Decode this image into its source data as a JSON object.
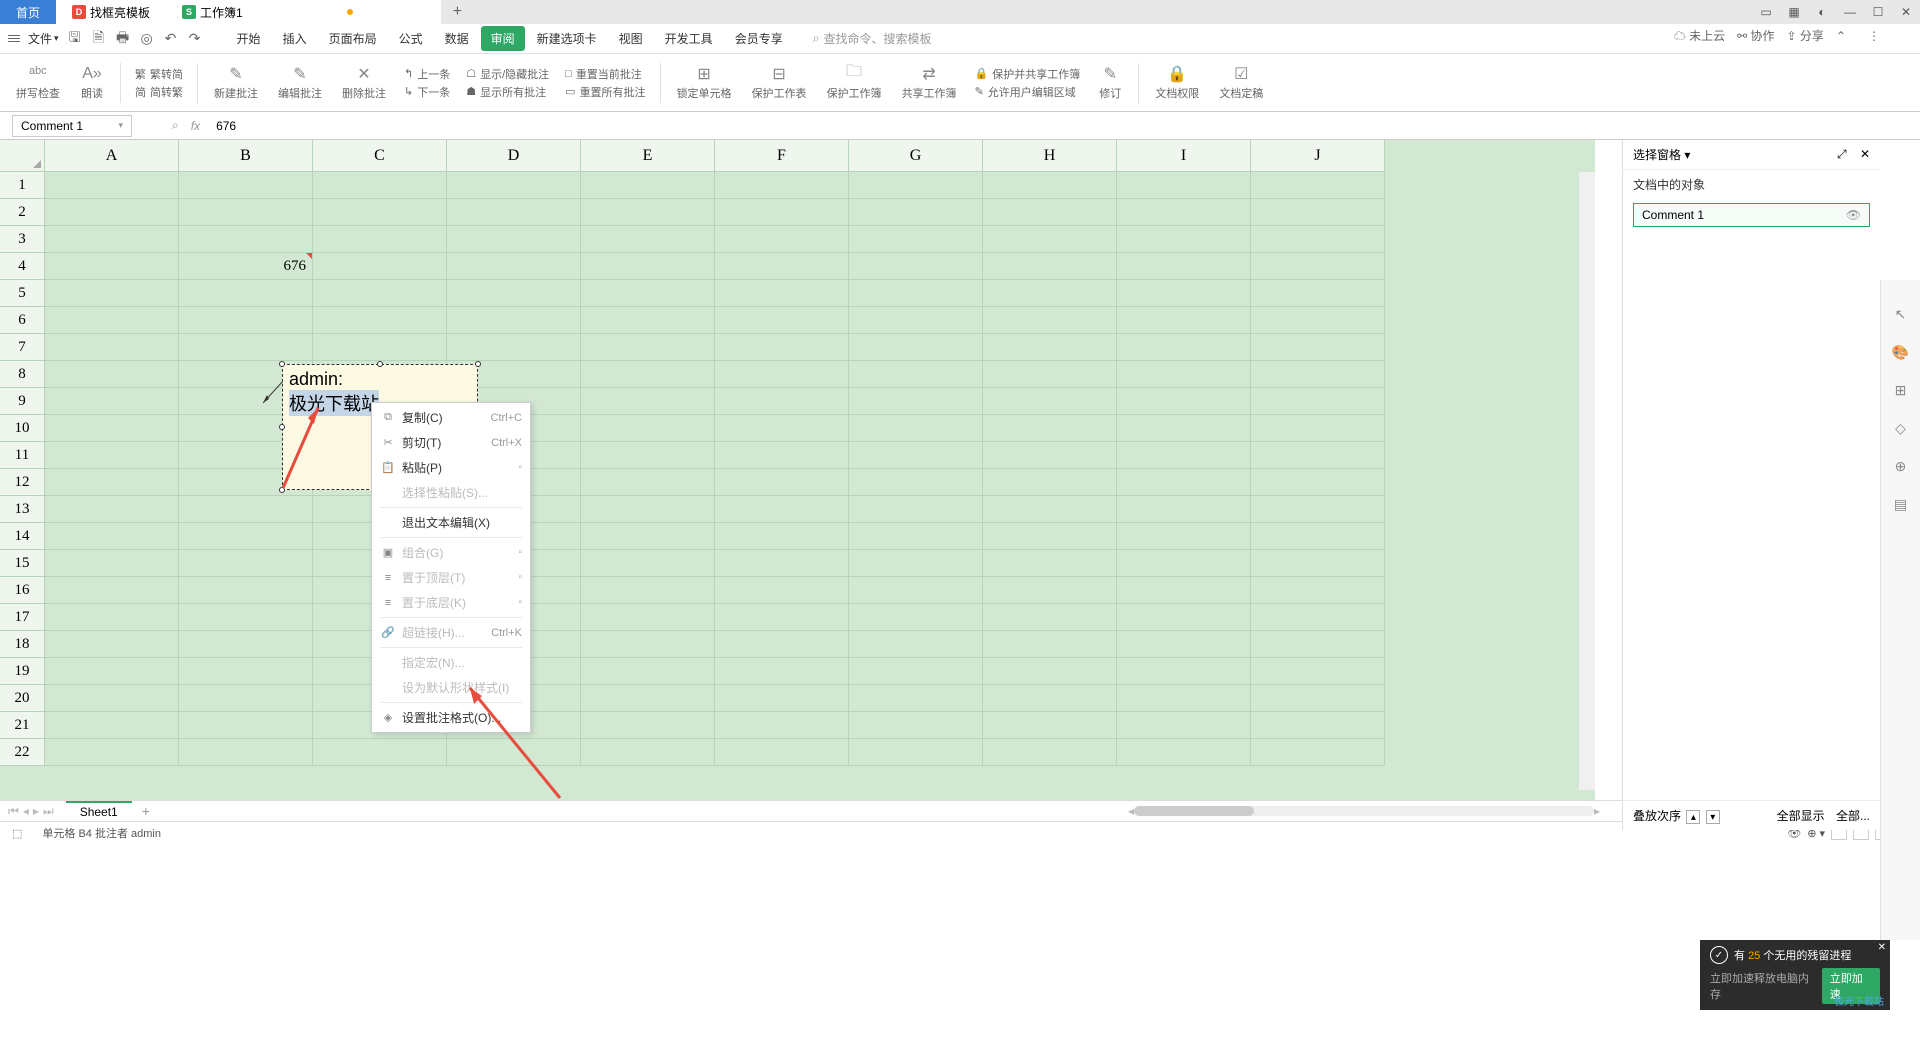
{
  "tabs": {
    "home": "首页",
    "doc1": "找框亮模板",
    "doc2": "工作簿1"
  },
  "file_menu": "文件",
  "menu": {
    "start": "开始",
    "insert": "插入",
    "layout": "页面布局",
    "formula": "公式",
    "data": "数据",
    "review": "审阅",
    "newtab": "新建选项卡",
    "view": "视图",
    "dev": "开发工具",
    "member": "会员专享"
  },
  "search_placeholder": "查找命令、搜索模板",
  "top_right": {
    "cloud": "未上云",
    "collab": "协作",
    "share": "分享"
  },
  "ribbon": {
    "spellcheck": "拼写检查",
    "read": "朗读",
    "simp_conv": "繁转简",
    "trad_conv": "简转繁",
    "new_comment": "新建批注",
    "edit_comment": "编辑批注",
    "delete_comment": "删除批注",
    "prev": "上一条",
    "next": "下一条",
    "show_hide": "显示/隐藏批注",
    "show_all": "显示所有批注",
    "reset_current": "重置当前批注",
    "reset_all": "重置所有批注",
    "lock_cell": "锁定单元格",
    "protect_sheet": "保护工作表",
    "protect_book": "保护工作簿",
    "share_book": "共享工作簿",
    "protect_share": "保护并共享工作簿",
    "allow_edit": "允许用户编辑区域",
    "revision": "修订",
    "doc_perm": "文档权限",
    "doc_verify": "文档定稿"
  },
  "name_box": "Comment 1",
  "formula": "676",
  "columns": [
    "A",
    "B",
    "C",
    "D",
    "E",
    "F",
    "G",
    "H",
    "I",
    "J"
  ],
  "cell_b4": "676",
  "comment": {
    "author": "admin:",
    "body": "极光下载站"
  },
  "context": {
    "copy": "复制(C)",
    "copy_sc": "Ctrl+C",
    "cut": "剪切(T)",
    "cut_sc": "Ctrl+X",
    "paste": "粘贴(P)",
    "paste_special": "选择性粘贴(S)...",
    "exit_edit": "退出文本编辑(X)",
    "group": "组合(G)",
    "top": "置于顶层(T)",
    "bottom": "置于底层(K)",
    "hyperlink": "超链接(H)...",
    "hyperlink_sc": "Ctrl+K",
    "assign_macro": "指定宏(N)...",
    "default_shape": "设为默认形状样式(I)",
    "format_comment": "设置批注格式(O)..."
  },
  "side": {
    "title": "选择窗格",
    "section": "文档中的对象",
    "item1": "Comment 1",
    "stack_order": "叠放次序",
    "show_all": "全部显示",
    "hide_all": "全部..."
  },
  "sheet_tab": "Sheet1",
  "status": "单元格 B4 批注者 admin",
  "notif": {
    "line1_a": "有",
    "line1_b": "25",
    "line1_c": "个无用的残留进程",
    "line2": "立即加速释放电脑内存",
    "btn": "立即加速",
    "brand": "极光下载站"
  }
}
